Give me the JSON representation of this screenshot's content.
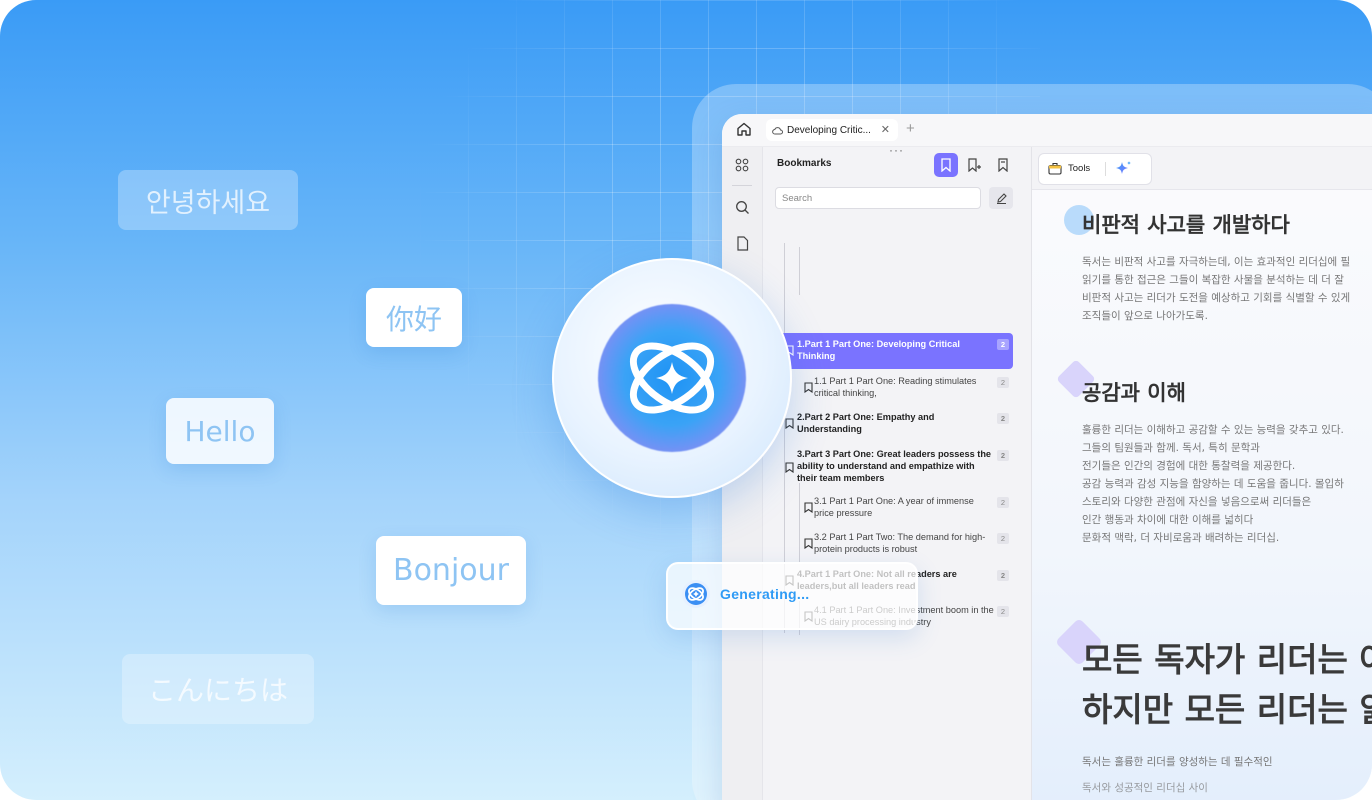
{
  "greetings": {
    "korean": "안녕하세요",
    "chinese": "你好",
    "english": "Hello",
    "french": "Bonjour",
    "japanese": "こんにちは"
  },
  "browser": {
    "tab_title": "Developing Critic...",
    "home_icon": "home-icon",
    "close_icon": "close-icon",
    "new_tab_icon": "plus-icon"
  },
  "bookmarks_panel": {
    "title": "Bookmarks",
    "search_placeholder": "Search",
    "items": [
      {
        "label": "1.Part 1 Part One: Developing Critical Thinking",
        "count": "2"
      },
      {
        "label": "1.1 Part 1 Part One: Reading stimulates critical thinking,",
        "count": "2"
      },
      {
        "label": "2.Part 2 Part One: Empathy and Understanding",
        "count": "2"
      },
      {
        "label": "3.Part 3 Part One: Great leaders possess the ability to understand and empathize with their team members",
        "count": "2"
      },
      {
        "label": "3.1 Part 1 Part One: A year of immense price pressure",
        "count": "2"
      },
      {
        "label": "3.2 Part 1 Part Two: The demand for high-protein products is robust",
        "count": "2"
      },
      {
        "label": "4.Part 1 Part One: Not all readers are leaders,but all leaders read",
        "count": "2"
      },
      {
        "label": "4.1 Part 1 Part One: Investment boom in the US dairy processing industry",
        "count": "2"
      }
    ]
  },
  "tools": {
    "label": "Tools"
  },
  "document": {
    "h1": "비판적 사고를 개발하다",
    "p1": [
      "독서는 비판적 사고를 자극하는데, 이는 효과적인 리더십에 필",
      "읽기를 통한 접근은 그들이 복잡한 사물을 분석하는 데 더 잘",
      "비판적 사고는 리더가 도전을 예상하고 기회를 식별할 수 있게",
      "조직들이 앞으로 나아가도록."
    ],
    "h2": "공감과 이해",
    "p2": [
      "훌륭한 리더는 이해하고 공감할 수 있는 능력을 갖추고 있다.",
      "그들의 팀원들과 함께. 독서, 특히 문학과",
      "전기들은 인간의 경험에 대한 통찰력을 제공한다.",
      "공감 능력과 감성 지능을 함양하는 데 도움을 줍니다. 몰입하",
      "스토리와 다양한 관점에 자신을 넣음으로써 리더들은",
      "인간 행동과 차이에 대한 이해를 넓히다",
      "문화적 맥락, 더 자비로움과 배려하는 리더십."
    ],
    "h3_line1": "모든 독자가 리더는 아",
    "h3_line2": "하지만 모든 리더는 읽",
    "p3": [
      "독서는 훌륭한 리더를 양성하는 데 필수적인",
      "독서와 성공적인 리더십 사이"
    ]
  },
  "generating": {
    "label": "Generating..."
  },
  "colors": {
    "accent": "#7a73ff",
    "brand_blue": "#2f9bf5",
    "background_top": "#3a9bf6"
  }
}
